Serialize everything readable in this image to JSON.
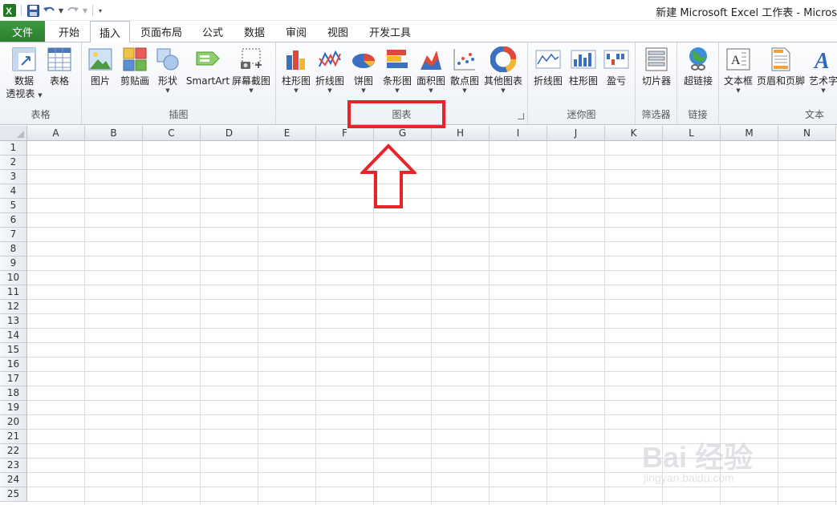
{
  "window": {
    "title": "新建 Microsoft Excel 工作表 - Micros"
  },
  "tabs": {
    "file": "文件",
    "items": [
      "开始",
      "插入",
      "页面布局",
      "公式",
      "数据",
      "审阅",
      "视图",
      "开发工具"
    ],
    "active": "插入"
  },
  "ribbon": {
    "groups": {
      "tables": {
        "label": "表格",
        "buttons": [
          "数据\n透视表",
          "表格"
        ]
      },
      "illustrations": {
        "label": "插图",
        "buttons": [
          "图片",
          "剪贴画",
          "形状",
          "SmartArt",
          "屏幕截图"
        ]
      },
      "charts": {
        "label": "图表",
        "buttons": [
          "柱形图",
          "折线图",
          "饼图",
          "条形图",
          "面积图",
          "散点图",
          "其他图表"
        ]
      },
      "sparklines": {
        "label": "迷你图",
        "buttons": [
          "折线图",
          "柱形图",
          "盈亏"
        ]
      },
      "filter": {
        "label": "筛选器",
        "buttons": [
          "切片器"
        ]
      },
      "links": {
        "label": "链接",
        "buttons": [
          "超链接"
        ]
      },
      "text": {
        "label": "文本",
        "buttons": [
          "文本框",
          "页眉和页脚",
          "艺术字"
        ]
      }
    },
    "pivot_line1": "数据",
    "pivot_line2": "透视表"
  },
  "sheet": {
    "columns": [
      "A",
      "B",
      "C",
      "D",
      "E",
      "F",
      "G",
      "H",
      "I",
      "J",
      "K",
      "L",
      "M",
      "N"
    ],
    "rows": [
      "1",
      "2",
      "3",
      "4",
      "5",
      "6",
      "7",
      "8",
      "9",
      "10",
      "11",
      "12",
      "13",
      "14",
      "15",
      "16",
      "17",
      "18",
      "19",
      "20",
      "21",
      "22",
      "23",
      "24",
      "25"
    ]
  },
  "watermark": {
    "text": "Bai 经验",
    "sub": "jingyan.baidu.com"
  },
  "colors": {
    "accent_green": "#2c7e2e",
    "highlight_red": "#e8232a"
  }
}
